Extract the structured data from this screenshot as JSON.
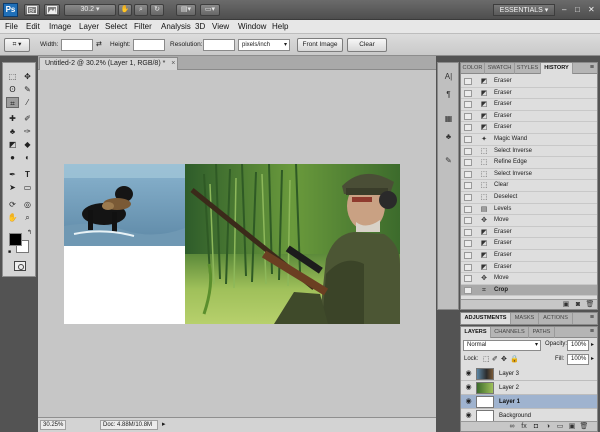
{
  "appbar": {
    "logo": "Ps",
    "zoom": "30.2",
    "workspace": "ESSENTIALS",
    "window_controls": {
      "minimize": "–",
      "restore": "□",
      "close": "✕"
    }
  },
  "menu": [
    "File",
    "Edit",
    "Image",
    "Layer",
    "Select",
    "Filter",
    "Analysis",
    "3D",
    "View",
    "Window",
    "Help"
  ],
  "options": {
    "width_label": "Width:",
    "height_label": "Height:",
    "resolution_label": "Resolution:",
    "width_value": "",
    "height_value": "",
    "resolution_value": "",
    "units": "pixels/inch",
    "front_image": "Front Image",
    "clear": "Clear"
  },
  "document": {
    "tab_title": "Untitled-2 @ 30.2% (Layer 1, RGB/8) *",
    "tab_close": "×"
  },
  "status": {
    "zoom": "30.25%",
    "doc": "Doc: 4.88M/10.8M"
  },
  "history": {
    "tabs": [
      "COLOR",
      "SWATCH",
      "STYLES",
      "HISTORY"
    ],
    "active_tab": "HISTORY",
    "items": [
      "Eraser",
      "Eraser",
      "Eraser",
      "Eraser",
      "Eraser",
      "Magic Wand",
      "Select Inverse",
      "Refine Edge",
      "Select Inverse",
      "Clear",
      "Deselect",
      "Levels",
      "Move",
      "Eraser",
      "Eraser",
      "Eraser",
      "Eraser",
      "Move",
      "Crop"
    ],
    "current": "Crop"
  },
  "adjustments": {
    "tabs": [
      "ADJUSTMENTS",
      "MASKS",
      "ACTIONS"
    ]
  },
  "layers": {
    "tabs": [
      "LAYERS",
      "CHANNELS",
      "PATHS"
    ],
    "blend_mode": "Normal",
    "opacity_label": "Opacity:",
    "opacity_value": "100%",
    "lock_label": "Lock:",
    "fill_label": "Fill:",
    "fill_value": "100%",
    "items": [
      {
        "name": "Layer 3",
        "selected": false
      },
      {
        "name": "Layer 2",
        "selected": false
      },
      {
        "name": "Layer 1",
        "selected": true
      },
      {
        "name": "Background",
        "selected": false
      }
    ]
  },
  "colors": {
    "foreground": "#000000",
    "background": "#ffffff",
    "accent": "#1f6fb8"
  }
}
